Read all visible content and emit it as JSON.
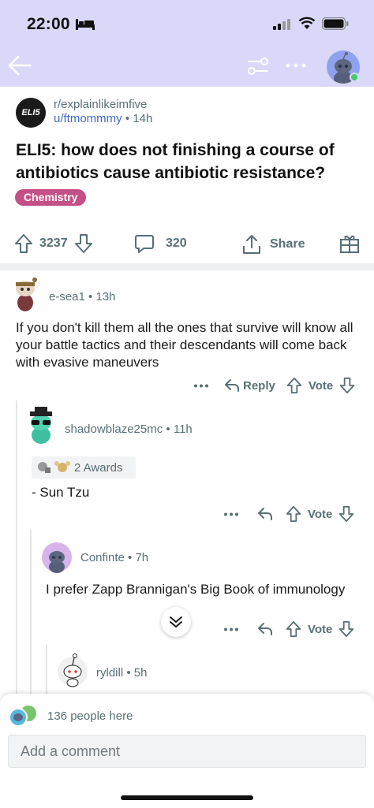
{
  "status_bar": {
    "time": "22:00"
  },
  "post": {
    "subreddit": "r/explainlikeimfive",
    "subreddit_icon_text": "ELI5",
    "author": "u/ftmommmy",
    "age": "14h",
    "title": "ELI5: how does not finishing a course of antibiotics cause antibiotic resistance?",
    "flair": "Chemistry",
    "votes": "3237",
    "comments": "320",
    "share_label": "Share"
  },
  "comments": [
    {
      "username": "e-sea1",
      "age": "13h",
      "text": "If you don't kill them all the ones that survive will know all your battle tactics and their descendants will come back with evasive maneuvers",
      "reply_label": "Reply",
      "vote_label": "Vote"
    },
    {
      "username": "shadowblaze25mc",
      "age": "11h",
      "awards": "2 Awards",
      "text": "- Sun Tzu",
      "vote_label": "Vote"
    },
    {
      "username": "Confinte",
      "age": "7h",
      "text": "I prefer Zapp Brannigan's Big Book of immunology",
      "vote_label": "Vote"
    },
    {
      "username": "ryldill",
      "age": "5h"
    }
  ],
  "bottom": {
    "people_here": "136 people here",
    "comment_placeholder": "Add a comment"
  },
  "colors": {
    "header_bg": "#d9d8f8",
    "flair_bg": "#c44f87",
    "author_link": "#3d6ac9",
    "meta_text": "#576f76"
  },
  "icons": [
    "bed-icon",
    "signal-icon",
    "wifi-icon",
    "battery-icon",
    "back-arrow-icon",
    "filter-icon",
    "more-icon",
    "upvote-icon",
    "downvote-icon",
    "comment-icon",
    "share-icon",
    "gift-icon",
    "reply-icon",
    "chevron-double-down-icon"
  ]
}
